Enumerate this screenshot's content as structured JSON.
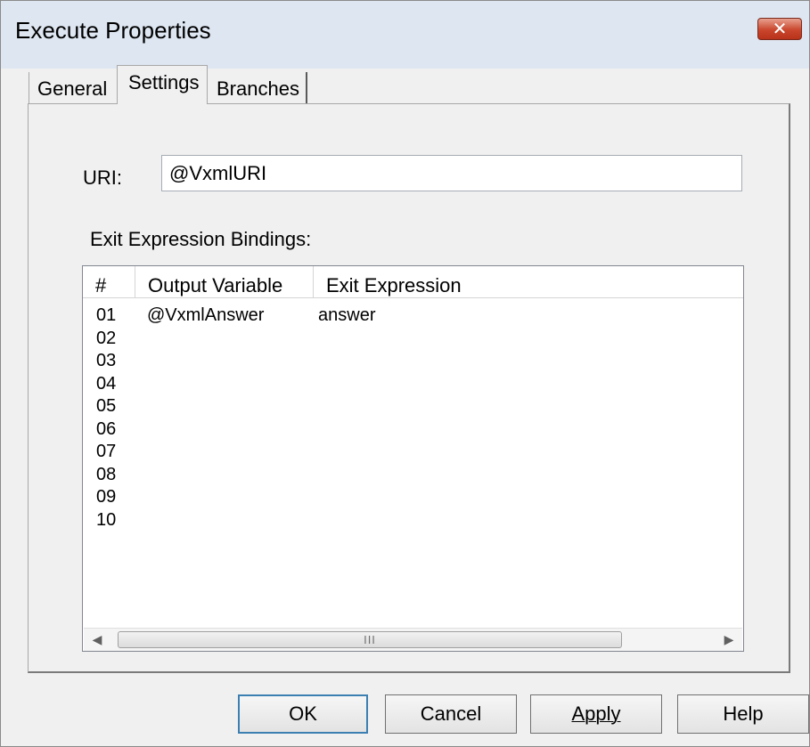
{
  "window": {
    "title": "Execute Properties",
    "close_glyph": "✕"
  },
  "tabs": [
    {
      "label": "General",
      "active": false
    },
    {
      "label": "Settings",
      "active": true
    },
    {
      "label": "Branches",
      "active": false
    }
  ],
  "settings": {
    "uri_label": "URI:",
    "uri_value": "@VxmlURI",
    "bindings_label": "Exit Expression Bindings:"
  },
  "bindings_table": {
    "columns": [
      "#",
      "Output Variable",
      "Exit Expression"
    ],
    "rows": [
      {
        "num": "01",
        "output": "@VxmlAnswer",
        "exit": "answer"
      },
      {
        "num": "02",
        "output": "",
        "exit": ""
      },
      {
        "num": "03",
        "output": "",
        "exit": ""
      },
      {
        "num": "04",
        "output": "",
        "exit": ""
      },
      {
        "num": "05",
        "output": "",
        "exit": ""
      },
      {
        "num": "06",
        "output": "",
        "exit": ""
      },
      {
        "num": "07",
        "output": "",
        "exit": ""
      },
      {
        "num": "08",
        "output": "",
        "exit": ""
      },
      {
        "num": "09",
        "output": "",
        "exit": ""
      },
      {
        "num": "10",
        "output": "",
        "exit": ""
      }
    ],
    "scroll_left_glyph": "◀",
    "scroll_right_glyph": "▶",
    "scroll_grip_glyph": "III"
  },
  "buttons": {
    "ok": "OK",
    "cancel": "Cancel",
    "apply": "Apply",
    "help": "Help"
  }
}
